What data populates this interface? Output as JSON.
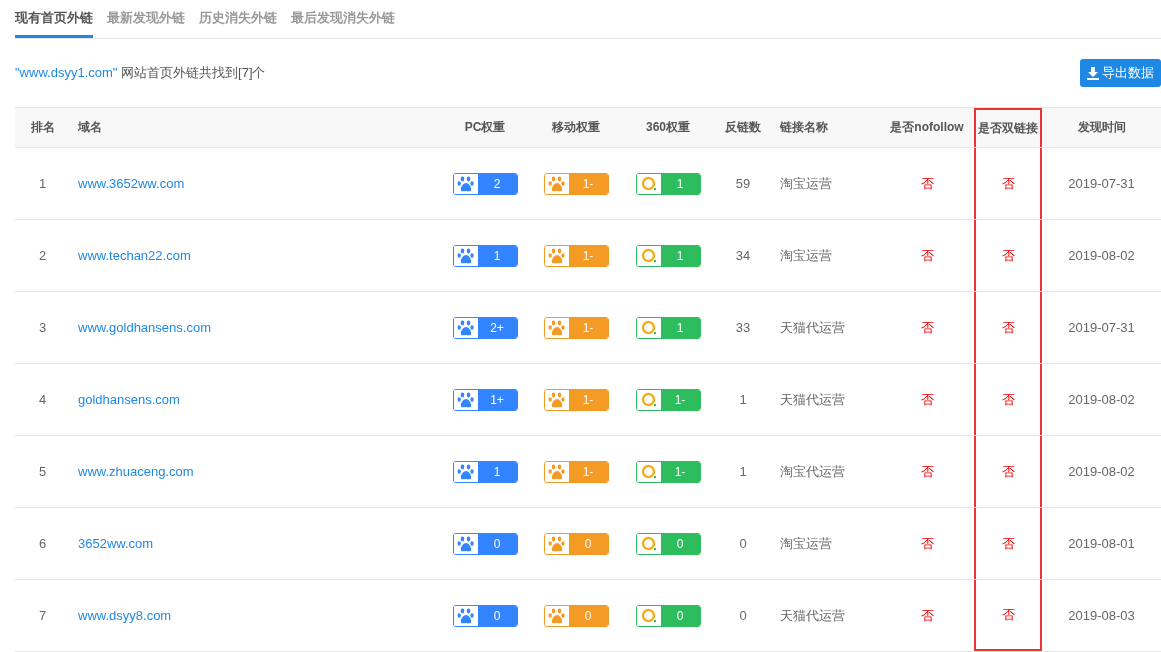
{
  "tabs": [
    {
      "label": "现有首页外链",
      "selected": true
    },
    {
      "label": "最新发现外链",
      "selected": false
    },
    {
      "label": "历史消失外链",
      "selected": false
    },
    {
      "label": "最后发现消失外链",
      "selected": false
    }
  ],
  "summary": {
    "domain": "\"www.dsyy1.com\"",
    "text": "网站首页外链共找到[7]个"
  },
  "export_button": {
    "label": "导出数据"
  },
  "table": {
    "columns": [
      {
        "label": "排名",
        "highlighted": false
      },
      {
        "label": "域名",
        "highlighted": false
      },
      {
        "label": "PC权重",
        "highlighted": false
      },
      {
        "label": "移动权重",
        "highlighted": false
      },
      {
        "label": "360权重",
        "highlighted": false
      },
      {
        "label": "反链数",
        "highlighted": false
      },
      {
        "label": "链接名称",
        "highlighted": false
      },
      {
        "label": "是否nofollow",
        "highlighted": false
      },
      {
        "label": "是否双链接",
        "highlighted": true
      },
      {
        "label": "发现时间",
        "highlighted": false
      }
    ],
    "rows": [
      {
        "rank": "1",
        "domain": "www.3652ww.com",
        "pc": "2",
        "mobile": "1-",
        "w360": "1",
        "backlinks": "59",
        "link_name": "淘宝运营",
        "nofollow": "否",
        "double_link": "否",
        "date": "2019-07-31"
      },
      {
        "rank": "2",
        "domain": "www.techan22.com",
        "pc": "1",
        "mobile": "1-",
        "w360": "1",
        "backlinks": "34",
        "link_name": "淘宝运营",
        "nofollow": "否",
        "double_link": "否",
        "date": "2019-08-02"
      },
      {
        "rank": "3",
        "domain": "www.goldhansens.com",
        "pc": "2+",
        "mobile": "1-",
        "w360": "1",
        "backlinks": "33",
        "link_name": "天猫代运营",
        "nofollow": "否",
        "double_link": "否",
        "date": "2019-07-31"
      },
      {
        "rank": "4",
        "domain": "goldhansens.com",
        "pc": "1+",
        "mobile": "1-",
        "w360": "1-",
        "backlinks": "1",
        "link_name": "天猫代运营",
        "nofollow": "否",
        "double_link": "否",
        "date": "2019-08-02"
      },
      {
        "rank": "5",
        "domain": "www.zhuaceng.com",
        "pc": "1",
        "mobile": "1-",
        "w360": "1-",
        "backlinks": "1",
        "link_name": "淘宝代运营",
        "nofollow": "否",
        "double_link": "否",
        "date": "2019-08-02"
      },
      {
        "rank": "6",
        "domain": "3652ww.com",
        "pc": "0",
        "mobile": "0",
        "w360": "0",
        "backlinks": "0",
        "link_name": "淘宝运营",
        "nofollow": "否",
        "double_link": "否",
        "date": "2019-08-01"
      },
      {
        "rank": "7",
        "domain": "www.dsyy8.com",
        "pc": "0",
        "mobile": "0",
        "w360": "0",
        "backlinks": "0",
        "link_name": "天猫代运营",
        "nofollow": "否",
        "double_link": "否",
        "date": "2019-08-03"
      }
    ]
  }
}
